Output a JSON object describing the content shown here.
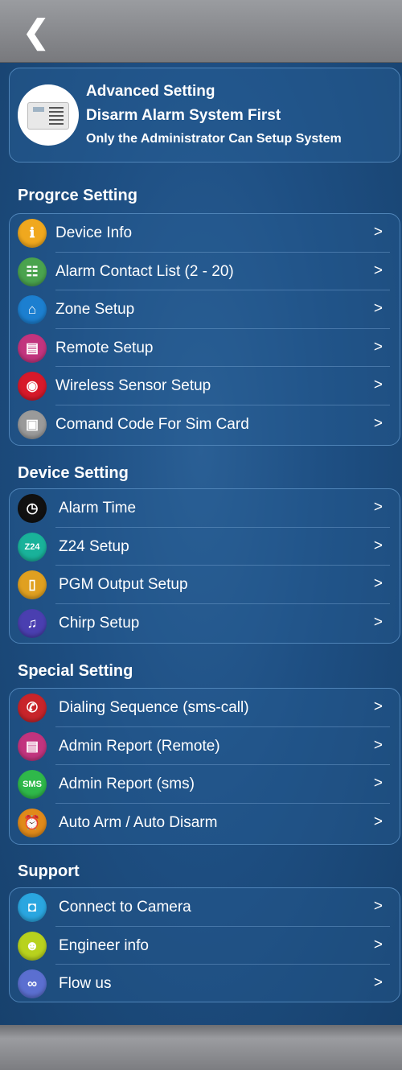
{
  "header": {
    "title": "Advanced Setting",
    "subtitle": "Disarm Alarm System First",
    "note": "Only the Administrator Can Setup System"
  },
  "nav": {
    "back_icon": "chevron-left-icon"
  },
  "sections": [
    {
      "title": "Progrce Setting",
      "items": [
        {
          "label": "Device Info",
          "icon": "info-icon",
          "color": "#f0a81e",
          "glyph": "ℹ"
        },
        {
          "label": "Alarm Contact List (2 - 20)",
          "icon": "contact-list-icon",
          "color": "#4aa34e",
          "glyph": "☷"
        },
        {
          "label": "Zone Setup",
          "icon": "zone-house-icon",
          "color": "#1c7fd0",
          "glyph": "⌂"
        },
        {
          "label": "Remote Setup",
          "icon": "remote-icon",
          "color": "#c2347e",
          "glyph": "▤"
        },
        {
          "label": "Wireless Sensor Setup",
          "icon": "wireless-sensor-icon",
          "color": "#d7192a",
          "glyph": "◉"
        },
        {
          "label": "Comand Code For Sim Card",
          "icon": "sim-card-icon",
          "color": "#9a9a9a",
          "glyph": "▣"
        }
      ]
    },
    {
      "title": "Device Setting",
      "items": [
        {
          "label": "Alarm Time",
          "icon": "alarm-clock-icon",
          "color": "#111111",
          "glyph": "◷"
        },
        {
          "label": "Z24 Setup",
          "icon": "z24-icon",
          "color": "#19b29a",
          "glyph": "Z24"
        },
        {
          "label": "PGM Output Setup",
          "icon": "door-icon",
          "color": "#e0a020",
          "glyph": "▯"
        },
        {
          "label": "Chirp Setup",
          "icon": "music-note-icon",
          "color": "#4a3fb0",
          "glyph": "♫"
        }
      ]
    },
    {
      "title": "Special Setting",
      "items": [
        {
          "label": "Dialing Sequence (sms-call)",
          "icon": "dial-chat-icon",
          "color": "#c8242a",
          "glyph": "✆"
        },
        {
          "label": "Admin Report (Remote)",
          "icon": "remote-report-icon",
          "color": "#c2347e",
          "glyph": "▤"
        },
        {
          "label": "Admin Report (sms)",
          "icon": "sms-icon",
          "color": "#2fb84a",
          "glyph": "SMS"
        },
        {
          "label": "Auto Arm / Auto Disarm",
          "icon": "auto-alarm-icon",
          "color": "#e08a1a",
          "glyph": "⏰"
        }
      ]
    },
    {
      "title": "Support",
      "items": [
        {
          "label": "Connect to Camera",
          "icon": "camera-icon",
          "color": "#2aa6e0",
          "glyph": "◘"
        },
        {
          "label": "Engineer info",
          "icon": "engineer-icon",
          "color": "#b8d21e",
          "glyph": "☻"
        },
        {
          "label": "Flow us",
          "icon": "link-icon",
          "color": "#5b6fd0",
          "glyph": "∞"
        }
      ]
    }
  ],
  "chevron": ">"
}
